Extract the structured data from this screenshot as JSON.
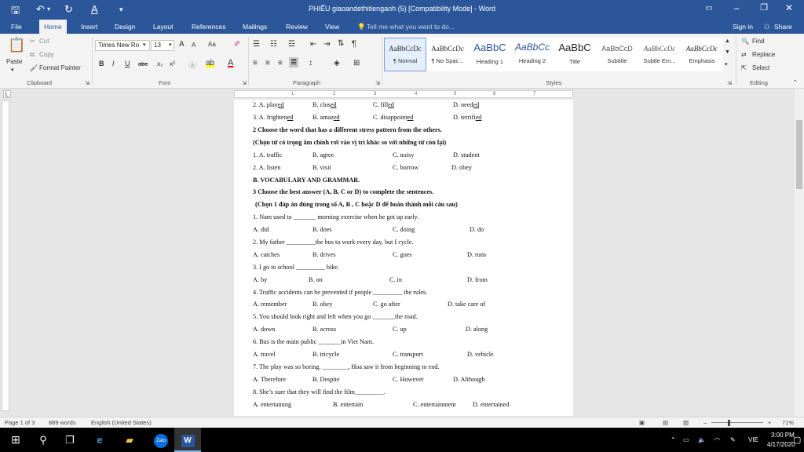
{
  "window": {
    "title": "PHIẾU giaoandethitienganh (5) [Compatibility Mode] - Word"
  },
  "tabs": [
    "File",
    "Home",
    "Insert",
    "Design",
    "Layout",
    "References",
    "Mailings",
    "Review",
    "View"
  ],
  "tell_me": "Tell me what you want to do...",
  "signin": "Sign in",
  "share": "Share",
  "clipboard": {
    "paste": "Paste",
    "cut": "Cut",
    "copy": "Copy",
    "format_painter": "Format Painter",
    "group": "Clipboard"
  },
  "font": {
    "name": "Times New Ro",
    "size": "13",
    "group": "Font",
    "bold": "B",
    "italic": "I",
    "underline": "U",
    "strike": "abc",
    "sub": "x₂",
    "sup": "x²",
    "grow": "A",
    "shrink": "A",
    "case": "Aa"
  },
  "paragraph": {
    "group": "Paragraph"
  },
  "styles": {
    "group": "Styles",
    "items": [
      {
        "sample": "AaBbCcDc",
        "label": "¶ Normal"
      },
      {
        "sample": "AaBbCcDc",
        "label": "¶ No Spac..."
      },
      {
        "sample": "AaBbC",
        "label": "Heading 1"
      },
      {
        "sample": "AaBbCc",
        "label": "Heading 2"
      },
      {
        "sample": "AaBbC",
        "label": "Title"
      },
      {
        "sample": "AaBbCcD",
        "label": "Subtitle"
      },
      {
        "sample": "AaBbCcDc",
        "label": "Subtle Em..."
      },
      {
        "sample": "AaBbCcDc",
        "label": "Emphasis"
      }
    ]
  },
  "editing": {
    "find": "Find",
    "replace": "Replace",
    "select": "Select",
    "group": "Editing"
  },
  "ruler_ticks": [
    "1",
    "2",
    "3",
    "4",
    "5",
    "6",
    "7"
  ],
  "doc": {
    "l1": {
      "a": "2. A. play",
      "au": "ed",
      "b": "B. clos",
      "bu": "ed",
      "c": "C. fill",
      "cu": "ed",
      "d": "D. need",
      "du": "ed"
    },
    "l2": {
      "a": "3. A. frighten",
      "au": "ed",
      "b": "B. amaz",
      "bu": "ed",
      "c": "C. disappoint",
      "cu": "ed",
      "d": "D. terrifi",
      "du": "ed"
    },
    "l3": "2 Choose the word that has a different stress pattern from the others.",
    "l4": "(Chọn từ có trọng âm chính rơi vào vị trí khác so với những từ còn lại)",
    "l5": [
      "1. A. traffic",
      "B. agree",
      "C. noisy",
      "D. student"
    ],
    "l6": [
      "2. A. listen",
      "B. visit",
      "C. borrow",
      "D. obey"
    ],
    "l7": "B. VOCABULARY AND GRAMMAR.",
    "l8": "3 Choose the best answer (A, B, C or D) to complete the sentences.",
    "l9": "(Chọn 1 đáp án đúng trong số A, B , C hoặc D để hoàn thành mỗi câu sau)",
    "q1": "1. Nam used to _______ morning exercise when he got up early.",
    "a1": [
      "A. did",
      "B. does",
      "C. doing",
      "D. do"
    ],
    "q2": "2. My father _________the bus to work every day, but I cycle.",
    "a2": [
      "A. catches",
      "B. drives",
      "C. goes",
      "D. runs"
    ],
    "q3": "3. I go to school _________ bike.",
    "a3": [
      "A. by",
      "B. on",
      "C. in",
      "D. from"
    ],
    "q4": "4. Traffic accidents can be prevented if people _________ the rules.",
    "a4": [
      "A. remember",
      "B. obey",
      "C. go after",
      "D. take care of"
    ],
    "q5": "5. You should look right and left when you go _______the road.",
    "a5": [
      "A. down",
      "B. across",
      "C. up",
      "D. along"
    ],
    "q6": "6. Bus is the main public _______in Viet Nam.",
    "a6": [
      "A. travel",
      "B. tricycle",
      "C. transport",
      "D. vehicle"
    ],
    "q7": "7. The play was so boring. ________, Hoa saw it from beginning to end.",
    "a7": [
      "A. Therefore",
      "B. Despite",
      "C. However",
      "D. Although"
    ],
    "q8": "8. She’s sure that they will find the film_________.",
    "a8": [
      "A. entertaining",
      "B. entertain",
      "C. entertainment",
      "D. entertained"
    ]
  },
  "status": {
    "page": "Page 1 of 3",
    "words": "889 words",
    "lang": "English (United States)",
    "zoom": "71%"
  },
  "taskbar": {
    "zalo": "Zalo",
    "word": "W"
  },
  "tray": {
    "lang": "VIE",
    "time": "3:00 PM",
    "date": "4/17/2020"
  },
  "colors": {
    "word_blue": "#2b579a"
  }
}
